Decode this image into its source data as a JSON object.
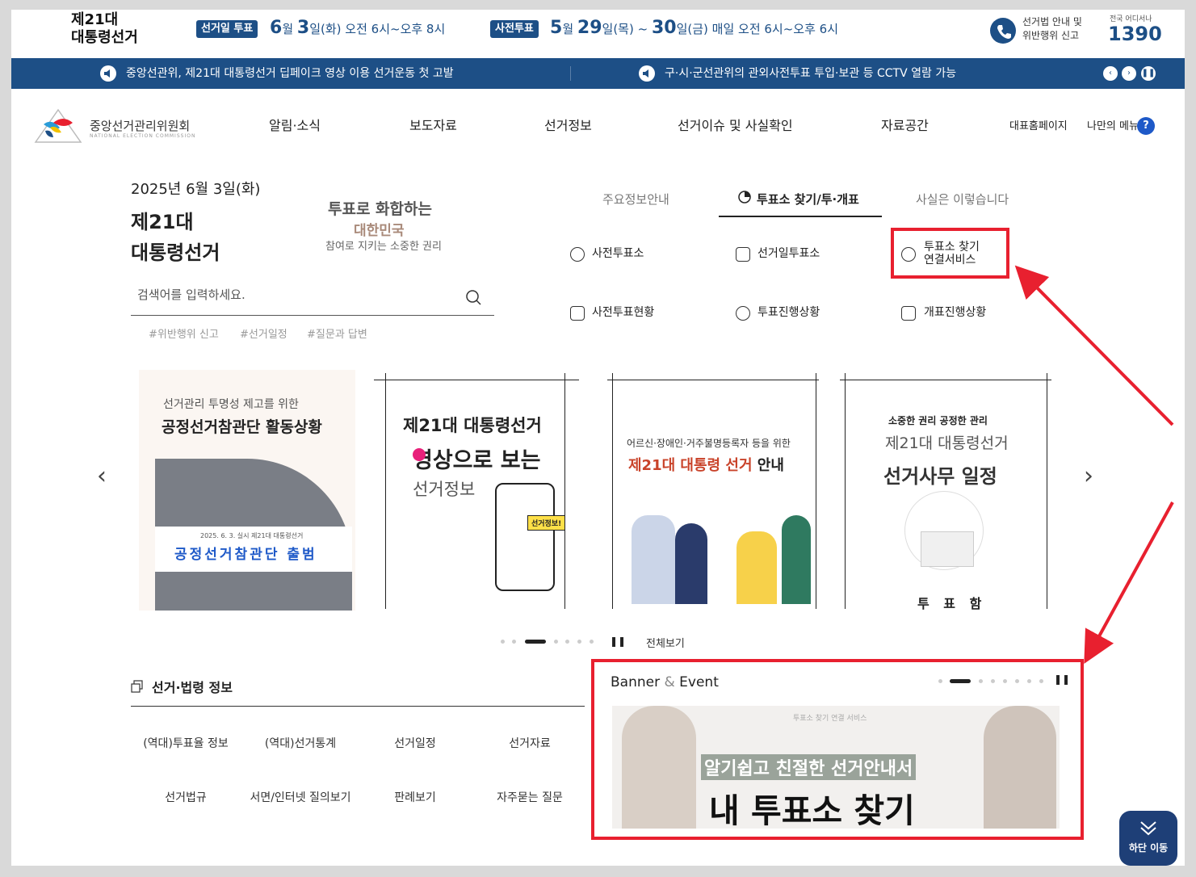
{
  "topbar": {
    "title_line1": "제21대",
    "title_line2": "대통령선거",
    "election_day_label": "선거일 투표",
    "election_day_date_month": "6",
    "election_day_date_day": "3",
    "election_day_text": "(화) 오전 6시~오후 8시",
    "early_vote_label": "사전투표",
    "early_vote_month": "5",
    "early_vote_day1": "29",
    "early_vote_mid": "(목) ~ ",
    "early_vote_day2": "30",
    "early_vote_text": "(금) 매일 오전 6시~오후 6시",
    "hotline_line1": "선거법 안내 및",
    "hotline_line2": "위반행위 신고",
    "hotline_small": "전국 어디서나",
    "hotline_number": "1390"
  },
  "ticker": {
    "item1": "중앙선관위, 제21대 대통령선거 딥페이크 영상 이용 선거운동 첫 고발",
    "item2": "구·시·군선관위의 관외사전투표 투입·보관 등 CCTV 열람 가능"
  },
  "nav": {
    "logo_name": "중앙선거관리위원회",
    "logo_sub": "NATIONAL ELECTION COMMISSION",
    "items": [
      "알림·소식",
      "보도자료",
      "선거정보",
      "선거이슈 및 사실확인",
      "자료공간"
    ],
    "home": "대표홈페이지",
    "my_menu": "나만의 메뉴",
    "help": "?"
  },
  "hero": {
    "date": "2025년 6월 3일(화)",
    "title1": "제21대",
    "title2": "대통령선거",
    "slogan1": "투표로 화합하는",
    "slogan2": "대한민국",
    "slogan3": "참여로 지키는 소중한 권리",
    "search_placeholder": "검색어를 입력하세요.",
    "tags": [
      "#위반행위 신고",
      "#선거일정",
      "#질문과 답변"
    ]
  },
  "tabs": {
    "items": [
      "주요정보안내",
      "투표소 찾기/투·개표",
      "사실은 이렇습니다"
    ],
    "services": [
      "사전투표소",
      "선거일투표소",
      "투표소 찾기",
      "연결서비스",
      "사전투표현황",
      "투표진행상황",
      "개표진행상황"
    ]
  },
  "cards": {
    "c1_line1": "선거관리 투명성 제고를 위한",
    "c1_line2": "공정선거참관단 활동상황",
    "c1_banner_small": "2025. 6. 3. 실시 제21대 대통령선거",
    "c1_banner": "공정선거참관단 출범",
    "c2_line1": "제21대 대통령선거",
    "c2_line2": "영상으로 보는",
    "c2_line3": "선거정보",
    "c2_bubble": "선거정보!",
    "c3_line1": "어르신·장애인·거주불명등록자 등을 위한",
    "c3_line2a": "제21대 대통령 선거",
    "c3_line2b": " 안내",
    "c4_line1": "소중한 권리 공정한 관리",
    "c4_line2": "제21대 대통령선거",
    "c4_line3": "선거사무 일정",
    "c4_box": "투 표 함",
    "view_all": "전체보기"
  },
  "law": {
    "title": "선거·법령 정보",
    "items": [
      "(역대)투표율 정보",
      "(역대)선거통계",
      "선거일정",
      "선거자료",
      "선거법규",
      "서면/인터넷 질의보기",
      "판례보기",
      "자주묻는 질문"
    ]
  },
  "banner": {
    "title_a": "Banner",
    "title_amp": " & ",
    "title_b": "Event",
    "small_caption": "투표소 찾기 연결 서비스",
    "caption1": "알기쉽고 친절한 선거안내서",
    "caption2": "내 투표소 찾기"
  },
  "bottom_button": "하단 이동",
  "colors": {
    "brand": "#1d4f86",
    "highlight": "#e8202f"
  }
}
